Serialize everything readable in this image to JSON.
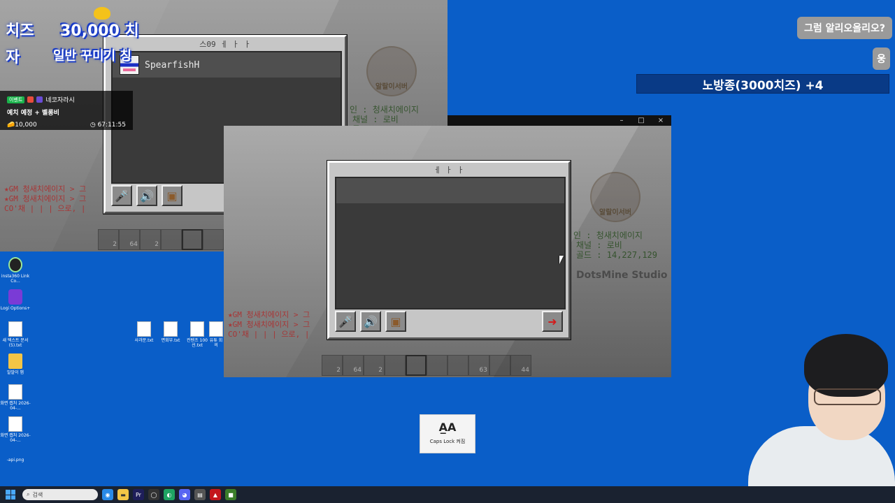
{
  "overlay": {
    "cheese_left_1": "치즈",
    "cheese_left_2": "자",
    "cheese_amount": "30,000 치",
    "cheese_sub": "일반 꾸미기 칭",
    "stats": {
      "tag": "이벤트",
      "channel": "네코자라시",
      "title": "예치 예정 + 벨롱비",
      "cheese": "10,000",
      "time": "67:11:55"
    }
  },
  "window_controls": {
    "minimize": "–",
    "maximize": "□",
    "close": "×"
  },
  "panel_top": {
    "title": "스09 ㅔ ㅏ ㅏ",
    "player_name": "SpearfishH"
  },
  "panel_bottom": {
    "title": "ㅔ ㅏ ㅏ"
  },
  "game_hud": {
    "server_logo_text": "알랄이서버",
    "info_name": "인 : 청새치에이지",
    "info_channel": "채널 : 로비",
    "info_gold": "골드 : 14,227,129",
    "studio": "DotsMine Studio",
    "chat_1": "★GM 청새치에이지 > 그",
    "chat_2": "★GM 청새치에이지 > 그",
    "chat_3": "CO'채 | | | 으로, |",
    "hotbar": [
      "2",
      "64",
      "2",
      "",
      "",
      "",
      "",
      "63",
      "",
      "44"
    ]
  },
  "chat": {
    "bubble_1": "그럼 알리오올리오?",
    "bubble_2": "웅",
    "donation": "노방종(3000치즈) +4"
  },
  "desktop": {
    "icons_left": [
      {
        "label": "insta360 Link Co...",
        "type": "dark"
      },
      {
        "label": "Logi Options+",
        "type": "logi"
      },
      {
        "label": "새 텍스트 문서 (5).txt",
        "type": "file"
      },
      {
        "label": "말말이 맵",
        "type": "folder"
      },
      {
        "label": "화면 캡처 2026-04-...",
        "type": "file"
      },
      {
        "label": "화면 캡처 2026-04-...",
        "type": "file"
      },
      {
        "label": "-api.png",
        "type": "none"
      }
    ],
    "icons_mid": [
      {
        "label": "사과문.txt"
      },
      {
        "label": "면회부.txt"
      },
      {
        "label": "컨텐츠 100선.txt"
      },
      {
        "label": "유튜 회의"
      }
    ],
    "capslock_text": "Caps Lock 켜짐"
  },
  "taskbar": {
    "search_placeholder": "검색"
  },
  "colors": {
    "desktop_bg": "#0a5ec8",
    "donation_bg": "#093a86",
    "mc_panel": "#c6c6c6"
  }
}
